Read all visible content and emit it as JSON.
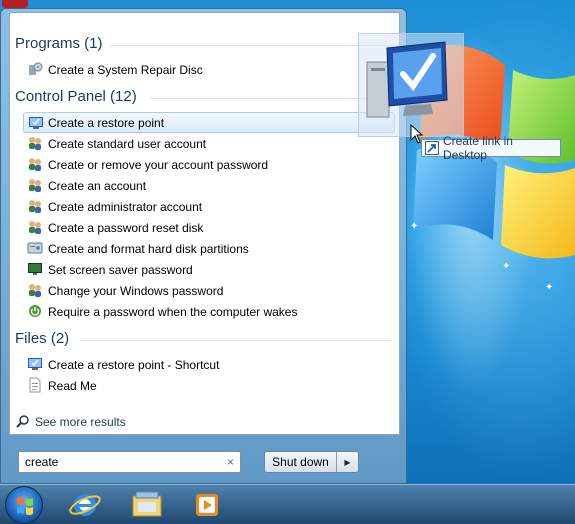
{
  "start_menu": {
    "groups": [
      {
        "header": "Programs (1)",
        "items": [
          {
            "label": "Create a System Repair Disc",
            "icon": "repair-disc-icon"
          }
        ]
      },
      {
        "header": "Control Panel (12)",
        "items": [
          {
            "label": "Create a restore point",
            "icon": "system-restore-icon",
            "selected": true
          },
          {
            "label": "Create standard user account",
            "icon": "user-accounts-icon"
          },
          {
            "label": "Create or remove your account password",
            "icon": "user-accounts-icon"
          },
          {
            "label": "Create an account",
            "icon": "user-accounts-icon"
          },
          {
            "label": "Create administrator account",
            "icon": "user-accounts-icon"
          },
          {
            "label": "Create a password reset disk",
            "icon": "user-accounts-icon"
          },
          {
            "label": "Create and format hard disk partitions",
            "icon": "disk-management-icon"
          },
          {
            "label": "Set screen saver password",
            "icon": "screen-saver-icon"
          },
          {
            "label": "Change your Windows password",
            "icon": "user-accounts-icon"
          },
          {
            "label": "Require a password when the computer wakes",
            "icon": "power-options-icon"
          }
        ]
      },
      {
        "header": "Files (2)",
        "items": [
          {
            "label": "Create a restore point - Shortcut",
            "icon": "system-restore-icon"
          },
          {
            "label": "Read Me",
            "icon": "text-document-icon"
          }
        ]
      }
    ],
    "see_more": "See more results",
    "search": {
      "value": "create",
      "clear_symbol": "×"
    },
    "shutdown": {
      "label": "Shut down",
      "arrow": "▶"
    }
  },
  "drag_tooltip": {
    "label": "Create link in Desktop"
  },
  "taskbar": {
    "items": [
      "start-orb",
      "internet-explorer-icon",
      "windows-explorer-icon",
      "media-player-icon"
    ]
  },
  "colors": {
    "accent": "#1e395b",
    "selection_border": "#a9cdf0",
    "desktop_blue": "#1e8fd6"
  }
}
